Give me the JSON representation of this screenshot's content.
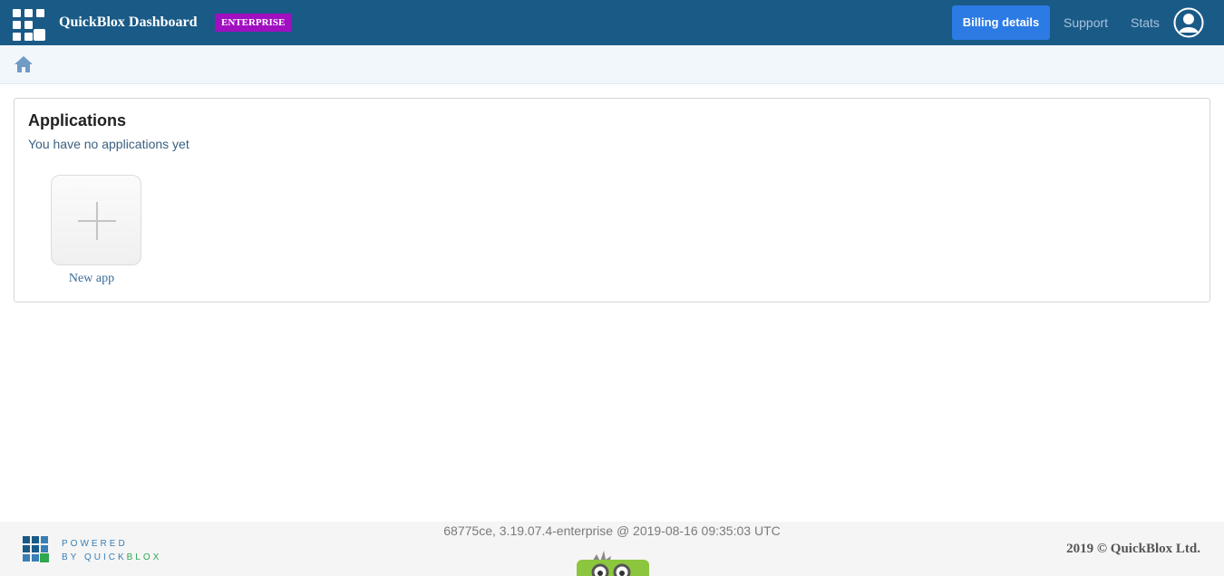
{
  "header": {
    "brand": "QuickBlox Dashboard",
    "badge": "ENTERPRISE",
    "billing_label": "Billing details",
    "nav": [
      "Support",
      "Stats"
    ]
  },
  "breadcrumb": {
    "icon": "home-icon"
  },
  "applications": {
    "title": "Applications",
    "empty_text": "You have no applications yet",
    "new_app_label": "New app"
  },
  "footer": {
    "powered_line1": "POWERED",
    "powered_by": "BY QUICK",
    "powered_brand": "BLOX",
    "version": "68775ce, 3.19.07.4-enterprise @ 2019-08-16 09:35:03 UTC",
    "copyright": "2019 © QuickBlox Ltd."
  },
  "colors": {
    "header_bg": "#1a5a87",
    "badge_bg": "#a010c0",
    "billing_bg": "#2c7be5",
    "link": "#3a6c96"
  }
}
